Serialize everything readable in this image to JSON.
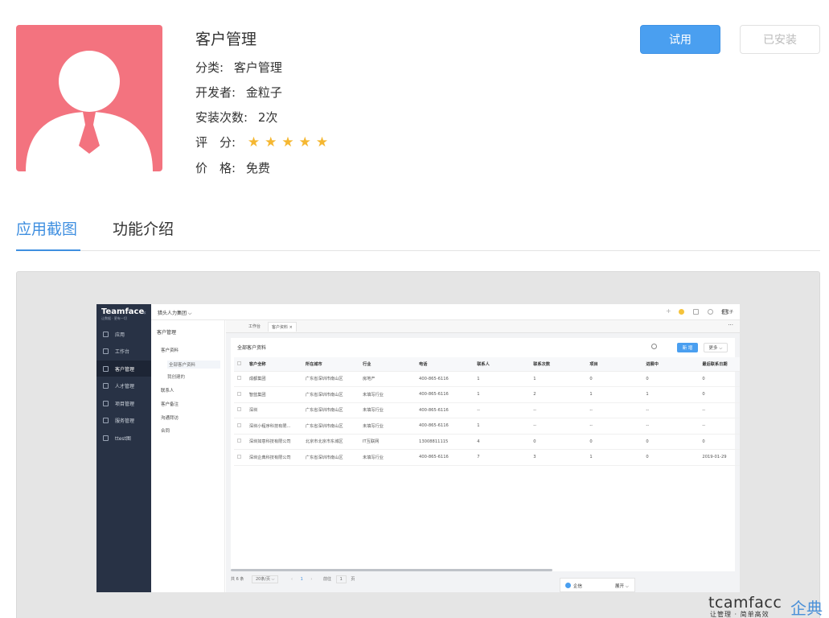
{
  "app": {
    "title": "客户管理",
    "category_label": "分类:",
    "category": "客户管理",
    "developer_label": "开发者:",
    "developer": "金粒子",
    "installs_label": "安装次数:",
    "installs": "2次",
    "rating_label": "评　分:",
    "rating": 5,
    "price_label": "价　格:",
    "price": "免费",
    "icon": "user-avatar-icon",
    "icon_bg": "#f3737f"
  },
  "actions": {
    "try_label": "试用",
    "installed_label": "已安装"
  },
  "tabs": [
    {
      "label": "应用截图",
      "active": true
    },
    {
      "label": "功能介绍",
      "active": false
    }
  ],
  "accent": "#3f8fe0",
  "screenshot": {
    "logo": "Teamface",
    "slogan": "让数据 · 更有一切",
    "group": "猎头人力集团 ⌵",
    "user": "金粒子",
    "sidebar": [
      "应用",
      "工作台",
      "客户管理",
      "人才管理",
      "项目管理",
      "服务管理",
      "ttest图"
    ],
    "sub_title": "客户管理",
    "sub_items": [
      "客户资料",
      "全部客户资料",
      "我创建的",
      "联系人",
      "客户备注",
      "沟通拜访",
      "合同"
    ],
    "tabs": [
      "工作台",
      "客户资料 ×"
    ],
    "panel_title": "全部客户资料",
    "new_label": "新 增",
    "more_label": "更多 ⌵",
    "columns": [
      "客户全称",
      "所在城市",
      "行业",
      "电话",
      "联系人",
      "联系次数",
      "项目",
      "进展中",
      "最后联系日期"
    ],
    "rows": [
      [
        "成都集团",
        "广东省深圳市南山区",
        "房地产",
        "400-865-6116",
        "1",
        "1",
        "0",
        "0",
        "0"
      ],
      [
        "智蓝集团",
        "广东省深圳市南山区",
        "未填写行业",
        "400-865-6116",
        "1",
        "2",
        "1",
        "1",
        "0"
      ],
      [
        "深圳",
        "广东省深圳市南山区",
        "未填写行业",
        "400-865-6116",
        "--",
        "--",
        "--",
        "--",
        "--"
      ],
      [
        "深圳小程序科技有限...",
        "广东省深圳市南山区",
        "未填写行业",
        "400-865-6116",
        "1",
        "--",
        "--",
        "--",
        "--"
      ],
      [
        "深圳如意科技有限公司",
        "北京市北京市东城区",
        "IT互联网",
        "13008811115",
        "4",
        "0",
        "0",
        "0",
        "0"
      ],
      [
        "深圳企典科技有限公司",
        "广东省深圳市南山区",
        "未填写行业",
        "400-865-6116",
        "7",
        "3",
        "1",
        "0",
        "2019-01-29"
      ]
    ],
    "footer_total": "共 6 条",
    "footer_pagesize": "20条/页 ⌵",
    "footer_page": "1",
    "footer_goto": "前往",
    "footer_goto_page": "1",
    "footer_goto_unit": "页",
    "chat_label": "企信",
    "chat_expand": "展开 ⌵"
  },
  "watermark": {
    "brand": "tcamfacc",
    "cn": "企典",
    "slogan": "让管理 · 简单高效"
  }
}
